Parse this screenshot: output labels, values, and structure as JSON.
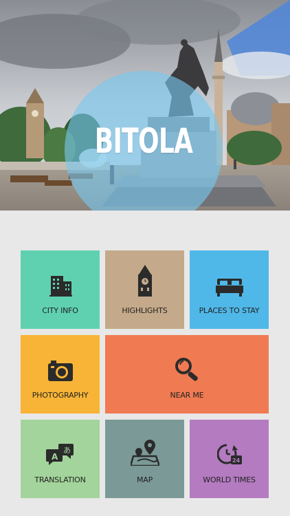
{
  "app": {
    "city_name": "BITOLA",
    "overlay_color": "#78c8f0"
  },
  "tiles": [
    {
      "id": "city-info",
      "label": "CITY INFO",
      "icon": "building-icon",
      "color": "#5fd1b1"
    },
    {
      "id": "highlights",
      "label": "HIGHLIGHTS",
      "icon": "clock-tower-icon",
      "color": "#c4aa8a"
    },
    {
      "id": "places",
      "label": "PLACES TO STAY",
      "icon": "bed-icon",
      "color": "#4fb8e8"
    },
    {
      "id": "photography",
      "label": "PHOTOGRAPHY",
      "icon": "camera-icon",
      "color": "#f8b436"
    },
    {
      "id": "near-me",
      "label": "NEAR ME",
      "icon": "magnifier-icon",
      "color": "#f07a52"
    },
    {
      "id": "translation",
      "label": "TRANSLATION",
      "icon": "translate-icon",
      "color": "#a3d49b"
    },
    {
      "id": "map",
      "label": "MAP",
      "icon": "map-pin-icon",
      "color": "#7b9a97"
    },
    {
      "id": "world-times",
      "label": "WORLD TIMES",
      "icon": "world-clock-icon",
      "color": "#b47bc0"
    }
  ]
}
